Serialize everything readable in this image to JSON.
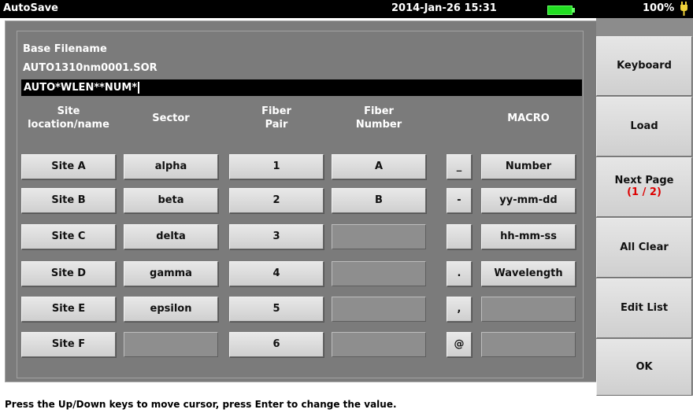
{
  "topbar": {
    "title": "AutoSave",
    "datetime": "2014-Jan-26 15:31",
    "battery_percent": "100%",
    "battery_level": 1.0
  },
  "form": {
    "base_label": "Base Filename",
    "base_value": "AUTO1310nm0001.SOR",
    "input_value": "AUTO*WLEN**NUM*"
  },
  "columns": {
    "site": [
      "Site",
      "location/name"
    ],
    "sector": "Sector",
    "fiber_pair": [
      "Fiber",
      "Pair"
    ],
    "fiber_number": [
      "Fiber",
      "Number"
    ],
    "macro": "MACRO"
  },
  "sites": [
    "Site A",
    "Site B",
    "Site C",
    "Site D",
    "Site E",
    "Site F"
  ],
  "sectors": [
    "alpha",
    "beta",
    "delta",
    "gamma",
    "epsilon",
    ""
  ],
  "fiber_pairs": [
    "1",
    "2",
    "3",
    "4",
    "5",
    "6"
  ],
  "fiber_numbers": [
    "A",
    "B",
    "",
    "",
    "",
    ""
  ],
  "symbols": [
    "_",
    "-",
    "",
    ".",
    ",",
    "@"
  ],
  "macros": [
    "Number",
    "yy-mm-dd",
    "hh-mm-ss",
    "Wavelength",
    "",
    ""
  ],
  "softkeys": {
    "keyboard": "Keyboard",
    "load": "Load",
    "next_page": "Next Page",
    "page_indicator": "(1 / 2)",
    "all_clear": "All Clear",
    "edit_list": "Edit List",
    "ok": "OK"
  },
  "status": "Press the Up/Down keys to move cursor, press Enter to change the value."
}
